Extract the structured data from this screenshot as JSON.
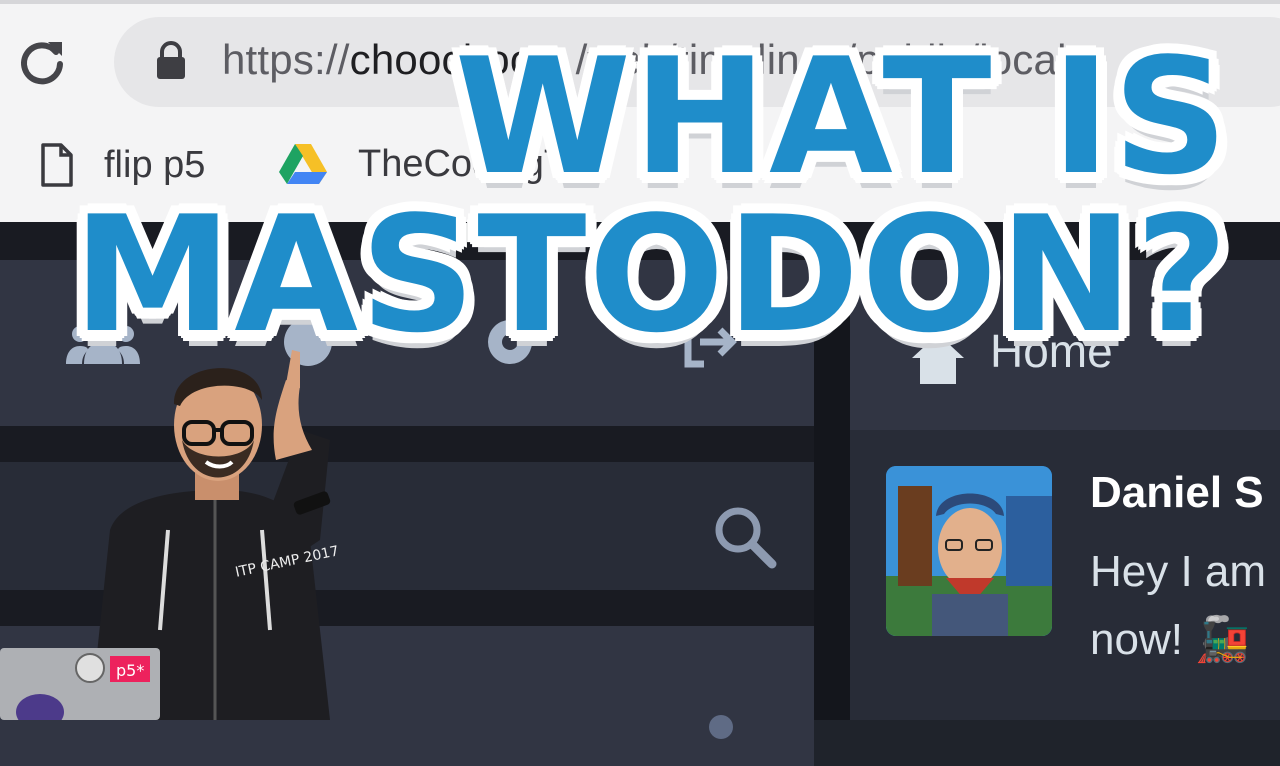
{
  "browser": {
    "url_prefix": "https://",
    "url_host": "choochoo",
    "url_rest": "…/web/timelines/public/local",
    "bookmarks": [
      {
        "label": "flip p5",
        "icon": "file-icon"
      },
      {
        "label": "TheCodingTra",
        "icon": "google-drive-icon"
      }
    ]
  },
  "title_overlay": {
    "line1": "WHAT IS",
    "line2": "MASTODON?",
    "color": "#1f8dca"
  },
  "mastodon": {
    "nav_icons": [
      "people-icon",
      "globe-icon",
      "gear-icon",
      "logout-icon"
    ],
    "column_header": "Home",
    "status": {
      "author": "Daniel S",
      "text_line1": "Hey I am",
      "text_line2": "now! 🚂"
    }
  },
  "presenter": {
    "hoodie_text": "ITP CAMP 2017",
    "laptop_sticker": "p5*"
  },
  "colors": {
    "app_bg": "#191b22",
    "panel": "#313543",
    "panel_dark": "#282c37",
    "chrome": "#f4f4f5"
  }
}
